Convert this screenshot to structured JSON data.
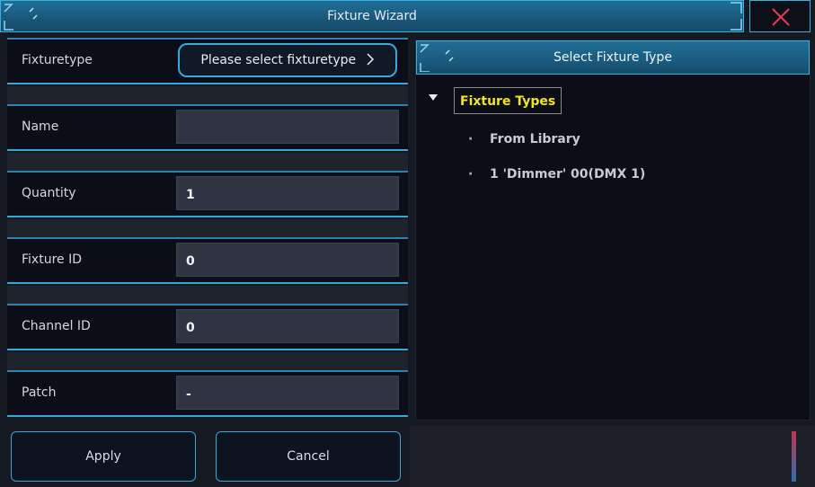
{
  "window": {
    "title": "Fixture Wizard",
    "close_icon": "close-x-icon"
  },
  "form": {
    "fixturetype": {
      "label": "Fixturetype",
      "button_label": "Please select fixturetype",
      "chevron_icon": "chevron-right-icon"
    },
    "name": {
      "label": "Name",
      "value": ""
    },
    "quantity": {
      "label": "Quantity",
      "value": "1"
    },
    "fixture_id": {
      "label": "Fixture ID",
      "value": "0"
    },
    "channel_id": {
      "label": "Channel ID",
      "value": "0"
    },
    "patch": {
      "label": "Patch",
      "value": "-"
    }
  },
  "buttons": {
    "apply": "Apply",
    "cancel": "Cancel"
  },
  "selector": {
    "title": "Select Fixture Type",
    "root_label": "Fixture Types",
    "items": [
      {
        "label": "From Library"
      },
      {
        "label": "1 'Dimmer' 00(DMX 1)"
      }
    ]
  },
  "colors": {
    "accent": "#3ba8dc",
    "header": "#1a5b7e",
    "root_label": "#f4e320",
    "background": "#151922"
  }
}
